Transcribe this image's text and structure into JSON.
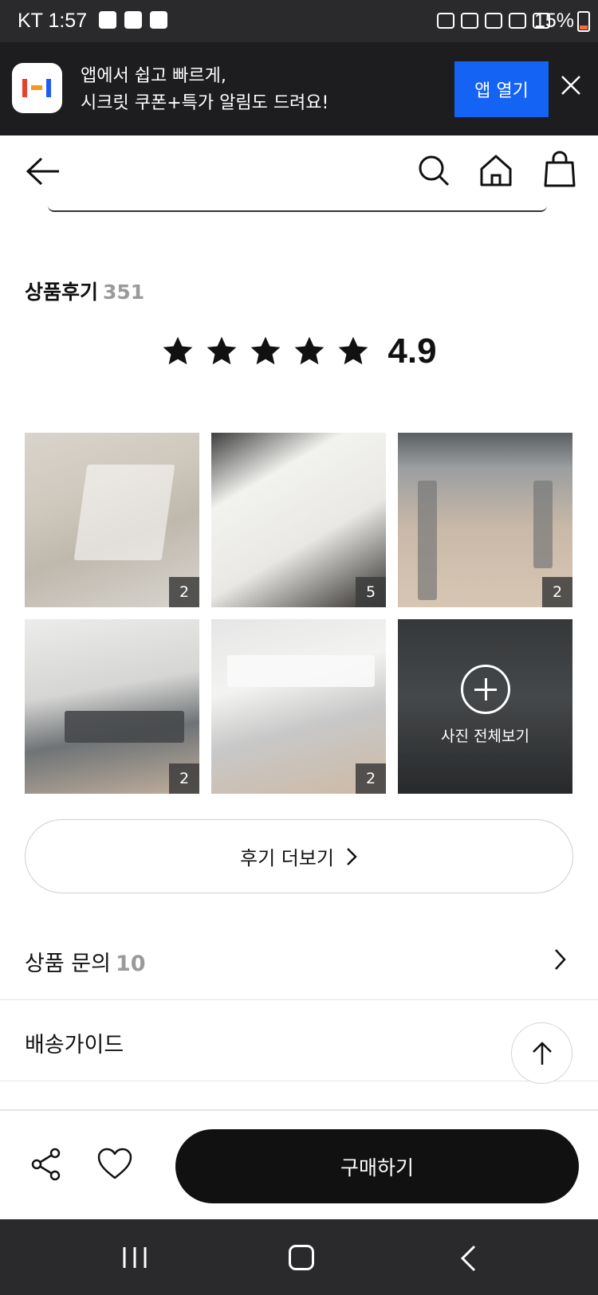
{
  "status_bar": {
    "carrier_time": "KT 1:57",
    "battery": "15%"
  },
  "app_banner": {
    "message_line1": "앱에서 쉽고 빠르게,",
    "message_line2": "시크릿 쿠폰+특가 알림도 드려요!",
    "open_button": "앱 열기"
  },
  "reviews": {
    "title": "상품후기",
    "count": "351",
    "rating": "4.9",
    "photos": [
      {
        "count": "2"
      },
      {
        "count": "5"
      },
      {
        "count": "2"
      },
      {
        "count": "2"
      },
      {
        "count": "2"
      }
    ],
    "view_all_photos": "사진 전체보기",
    "more_button": "후기 더보기"
  },
  "qna": {
    "title": "상품 문의",
    "count": "10"
  },
  "shipping": {
    "title": "배송가이드"
  },
  "action_bar": {
    "buy_button": "구매하기"
  },
  "colors": {
    "banner_bg": "#1d1d1f",
    "accent_blue": "#1463f5",
    "buy_bg": "#111111"
  }
}
